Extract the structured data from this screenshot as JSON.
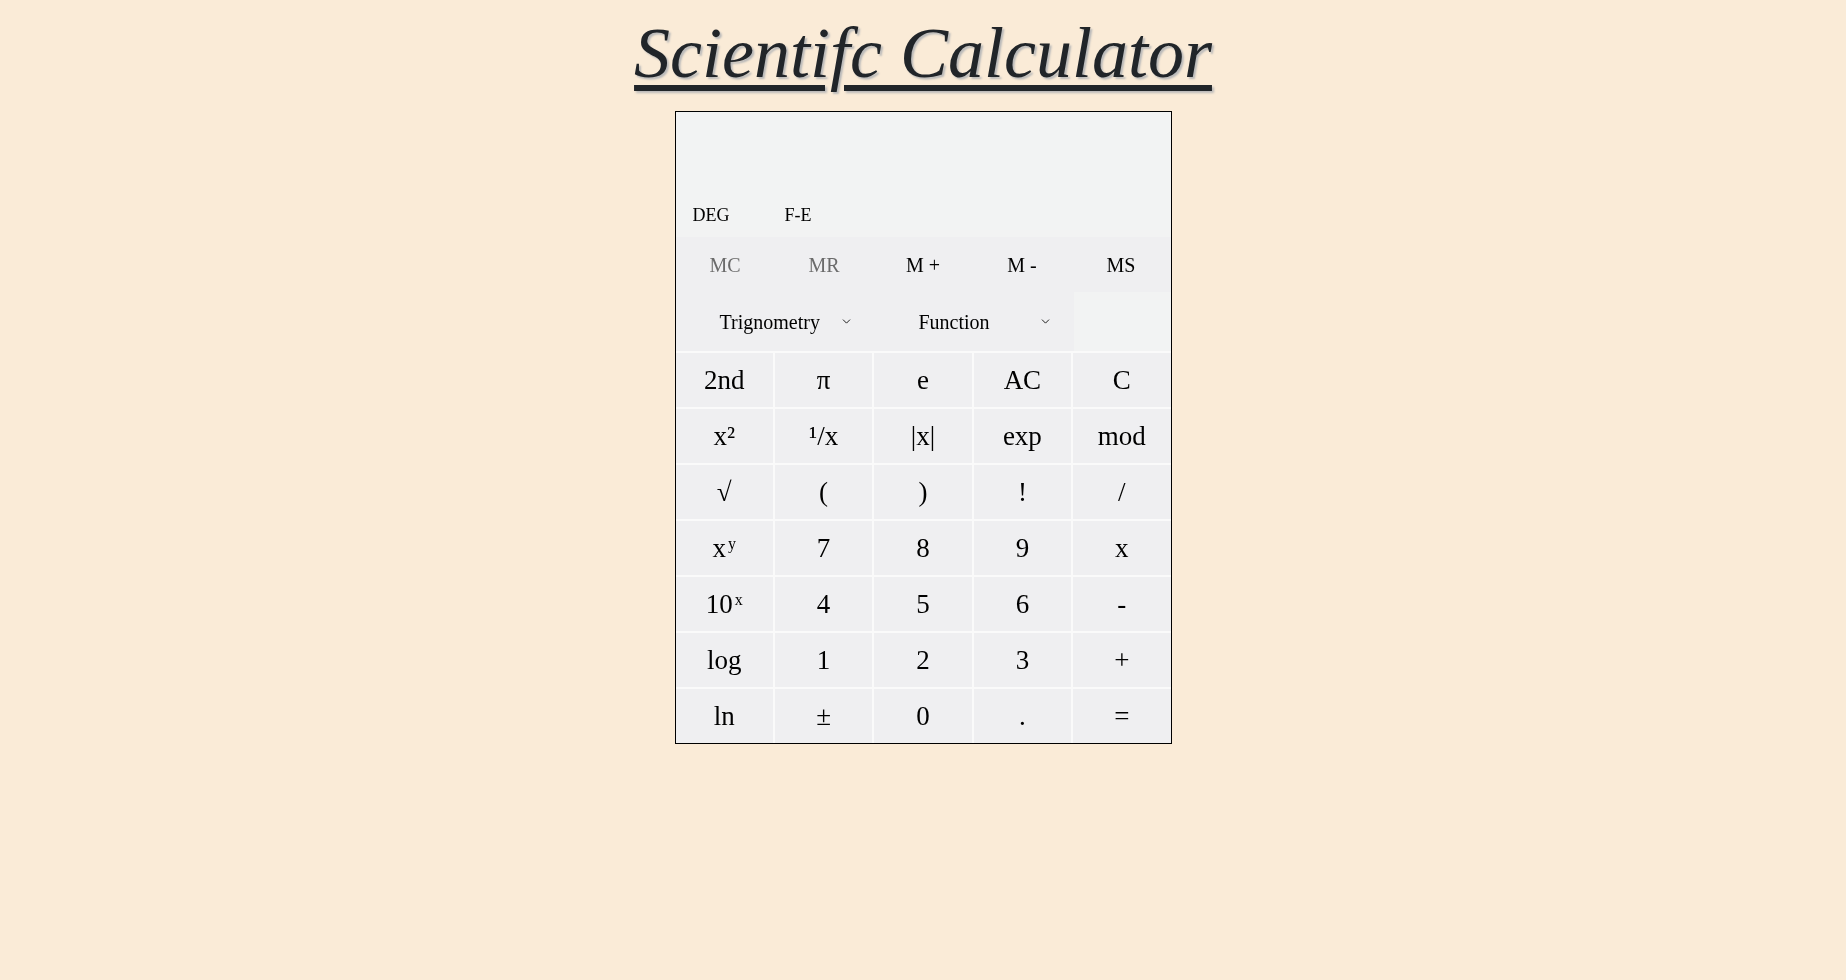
{
  "title": "Scientifc Calculator",
  "display": {
    "modes": [
      "DEG",
      "F-E"
    ]
  },
  "memory_buttons": [
    {
      "label": "MC",
      "disabled": true
    },
    {
      "label": "MR",
      "disabled": true
    },
    {
      "label": "M +",
      "disabled": false
    },
    {
      "label": "M -",
      "disabled": false
    },
    {
      "label": "MS",
      "disabled": false
    }
  ],
  "dropdowns": [
    {
      "label": "Trignometry"
    },
    {
      "label": "Function"
    }
  ],
  "keypad": [
    [
      "2nd",
      "π",
      "e",
      "AC",
      "C"
    ],
    [
      "x²",
      "¹/x",
      "|x|",
      "exp",
      "mod"
    ],
    [
      "√",
      "(",
      ")",
      "!",
      "/"
    ],
    [
      "x$^{y}$",
      "7",
      "8",
      "9",
      "x"
    ],
    [
      "10$^{x}$",
      "4",
      "5",
      "6",
      "-"
    ],
    [
      "log",
      "1",
      "2",
      "3",
      "+"
    ],
    [
      "ln",
      "±",
      "0",
      ".",
      "="
    ]
  ]
}
